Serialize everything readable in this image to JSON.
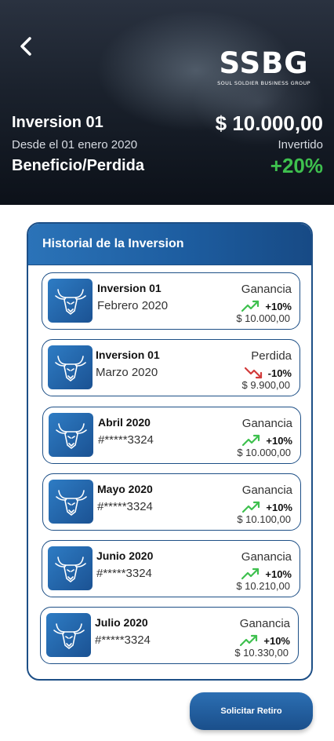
{
  "header": {
    "logo_mark": "SSBG",
    "logo_sub": "SOUL SOLDIER BUSINESS GROUP",
    "title": "Inversion 01",
    "date": "Desde el 01 enero 2020",
    "label": "Beneficio/Perdida",
    "amount": "$ 10.000,00",
    "invested_label": "Invertido",
    "percent": "+20%"
  },
  "history": {
    "title": "Historial de la Inversion",
    "items": [
      {
        "title": "Inversion 01",
        "subtitle": "Febrero 2020",
        "status": "Ganancia",
        "change": "+10%",
        "trend": "up",
        "value": "$ 10.000,00"
      },
      {
        "title": "Inversion 01",
        "subtitle": "Marzo 2020",
        "status": "Perdida",
        "change": "-10%",
        "trend": "down",
        "value": "$ 9.900,00"
      },
      {
        "title": "Abril 2020",
        "subtitle": "#*****3324",
        "status": "Ganancia",
        "change": "+10%",
        "trend": "up",
        "value": "$ 10.000,00"
      },
      {
        "title": "Mayo 2020",
        "subtitle": "#*****3324",
        "status": "Ganancia",
        "change": "+10%",
        "trend": "up",
        "value": "$ 10.100,00"
      },
      {
        "title": "Junio 2020",
        "subtitle": "#*****3324",
        "status": "Ganancia",
        "change": "+10%",
        "trend": "up",
        "value": "$ 10.210,00"
      },
      {
        "title": "Julio 2020",
        "subtitle": "#*****3324",
        "status": "Ganancia",
        "change": "+10%",
        "trend": "up",
        "value": "$ 10.330,00"
      }
    ]
  },
  "actions": {
    "withdraw_label": "Solicitar Retiro"
  },
  "colors": {
    "brand_blue": "#1d4f86",
    "gain_green": "#3ec04e",
    "loss_red": "#d23b3b"
  },
  "icons": {
    "back": "chevron-left-icon",
    "card": "bull-icon",
    "trend_up": "trend-up-icon",
    "trend_down": "trend-down-icon"
  }
}
